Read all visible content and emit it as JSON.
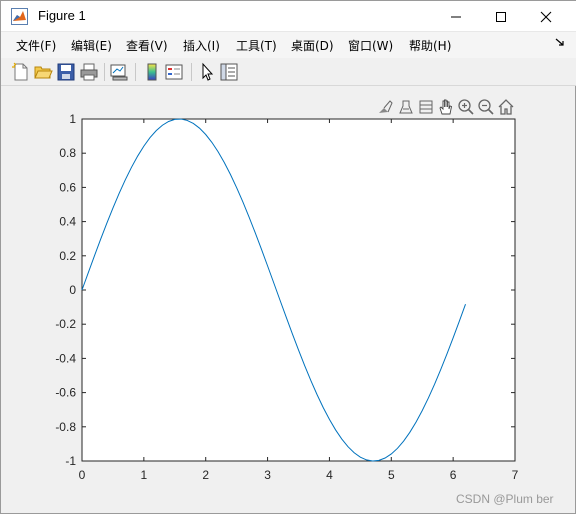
{
  "window": {
    "title": "Figure 1"
  },
  "menu": {
    "items": [
      {
        "label": "文件(F)"
      },
      {
        "label": "编辑(E)"
      },
      {
        "label": "查看(V)"
      },
      {
        "label": "插入(I)"
      },
      {
        "label": "工具(T)"
      },
      {
        "label": "桌面(D)"
      },
      {
        "label": "窗口(W)"
      },
      {
        "label": "帮助(H)"
      }
    ]
  },
  "toolbar": {
    "icons": [
      "new-figure-icon",
      "open-file-icon",
      "save-icon",
      "print-icon",
      "link-plot-icon",
      "colorbar-icon",
      "legend-icon",
      "select-pointer-icon",
      "property-inspector-icon"
    ]
  },
  "axes_toolbar": {
    "icons": [
      "brush-icon",
      "data-cursor-icon",
      "rotate-icon",
      "pan-icon",
      "zoom-in-icon",
      "zoom-out-icon",
      "home-icon"
    ]
  },
  "watermark": "CSDN @Plum ber",
  "colors": {
    "line": "#0072bd",
    "axes_bg": "#ffffff",
    "figure_bg": "#f0f0f0"
  },
  "chart_data": {
    "type": "line",
    "title": "",
    "xlabel": "",
    "ylabel": "",
    "xlim": [
      0,
      7
    ],
    "ylim": [
      -1,
      1
    ],
    "x_ticks": [
      "0",
      "1",
      "2",
      "3",
      "4",
      "5",
      "6",
      "7"
    ],
    "y_ticks": [
      "1",
      "0.8",
      "0.6",
      "0.4",
      "0.2",
      "0",
      "-0.2",
      "-0.4",
      "-0.6",
      "-0.8",
      "-1"
    ],
    "grid": false,
    "series": [
      {
        "x": [
          0.0,
          0.1,
          0.2,
          0.3,
          0.4,
          0.5,
          0.6,
          0.7,
          0.8,
          0.9,
          1.0,
          1.1,
          1.2,
          1.3,
          1.4,
          1.5,
          1.6,
          1.7,
          1.8,
          1.9,
          2.0,
          2.1,
          2.2,
          2.3,
          2.4,
          2.5,
          2.6,
          2.7,
          2.8,
          2.9,
          3.0,
          3.1,
          3.2,
          3.3,
          3.4,
          3.5,
          3.6,
          3.7,
          3.8,
          3.9,
          4.0,
          4.1,
          4.2,
          4.3,
          4.4,
          4.5,
          4.6,
          4.7,
          4.8,
          4.9,
          5.0,
          5.1,
          5.2,
          5.3,
          5.4,
          5.5,
          5.6,
          5.7,
          5.8,
          5.9,
          6.0,
          6.1,
          6.2
        ],
        "y": [
          0.0,
          0.0998,
          0.1987,
          0.2955,
          0.3894,
          0.4794,
          0.5646,
          0.6442,
          0.7174,
          0.7833,
          0.8415,
          0.8912,
          0.932,
          0.9636,
          0.9854,
          0.9975,
          0.9996,
          0.9917,
          0.9738,
          0.9463,
          0.9093,
          0.8632,
          0.8085,
          0.7457,
          0.6755,
          0.5985,
          0.5155,
          0.4274,
          0.335,
          0.2392,
          0.1411,
          0.0416,
          -0.0584,
          -0.1577,
          -0.2555,
          -0.3508,
          -0.4425,
          -0.5298,
          -0.6119,
          -0.6878,
          -0.7568,
          -0.8183,
          -0.8716,
          -0.9162,
          -0.9516,
          -0.9775,
          -0.9937,
          -0.9999,
          -0.9962,
          -0.9825,
          -0.9589,
          -0.9258,
          -0.8835,
          -0.8323,
          -0.7728,
          -0.7055,
          -0.6313,
          -0.5507,
          -0.4646,
          -0.3739,
          -0.2794,
          -0.1822,
          -0.0831
        ]
      }
    ]
  }
}
